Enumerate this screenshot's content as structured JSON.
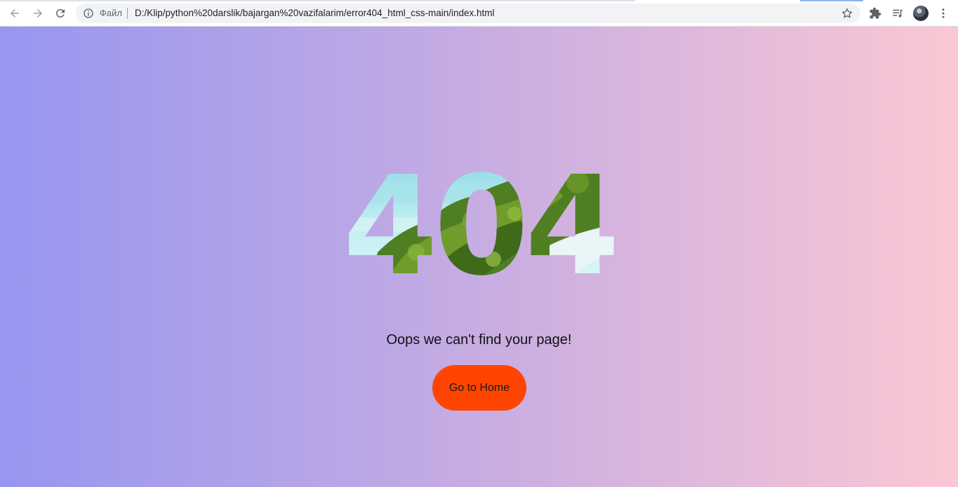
{
  "browser": {
    "scheme_label": "Файл",
    "url": "D:/Klip/python%20darslik/bajargan%20vazifalarim/error404_html_css-main/index.html",
    "icons": {
      "back": "arrow-left-icon",
      "forward": "arrow-right-icon",
      "reload": "reload-icon",
      "info": "info-icon",
      "bookmark": "star-icon",
      "extensions": "puzzle-icon",
      "media": "media-playlist-icon",
      "profile": "avatar",
      "menu": "kebab-menu-icon"
    }
  },
  "page": {
    "error_code": "404",
    "message": "Oops we can't find your page!",
    "home_button_label": "Go to Home",
    "colors": {
      "gradient_start": "#9796f0",
      "gradient_end": "#fbc7d4",
      "button_bg": "#ff4501"
    }
  }
}
